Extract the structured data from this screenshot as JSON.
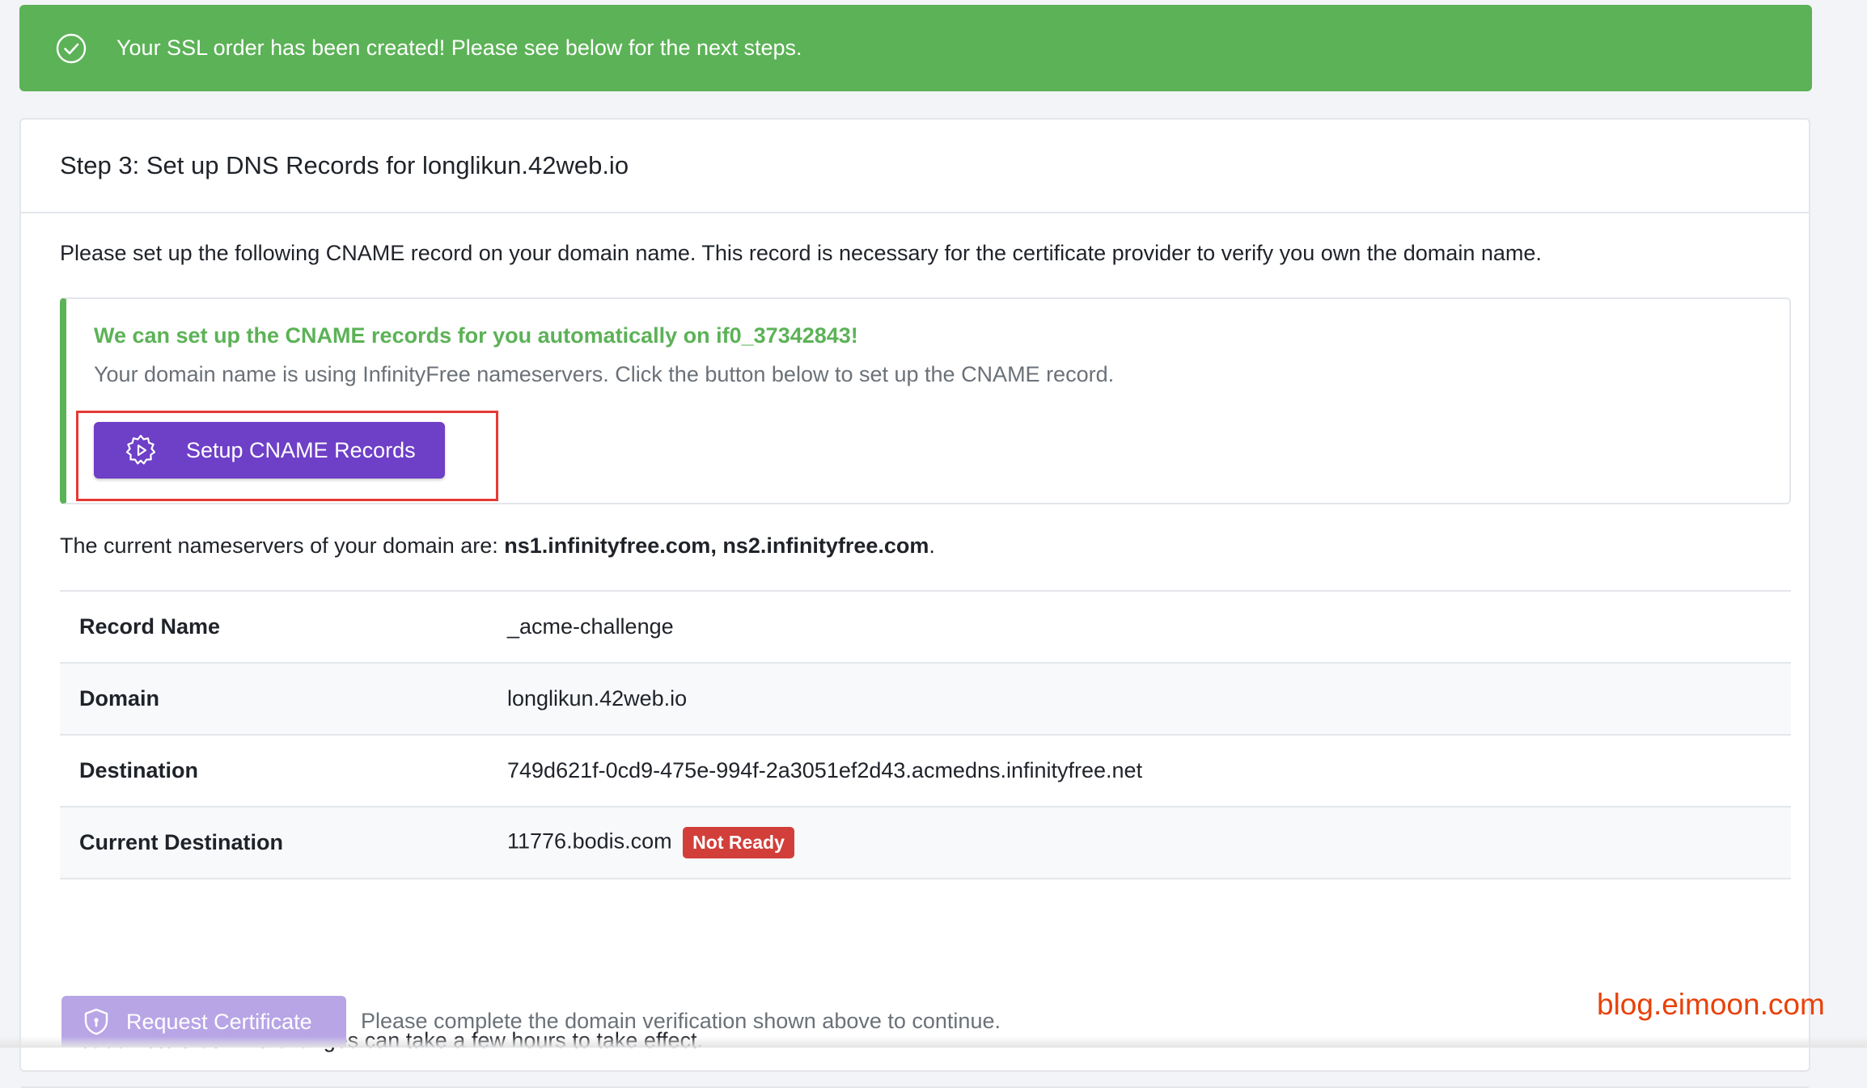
{
  "alert": {
    "message": "Your SSL order has been created! Please see below for the next steps.",
    "icon": "check-circle-icon"
  },
  "card": {
    "title": "Step 3: Set up DNS Records for longlikun.42web.io",
    "intro": "Please set up the following CNAME record on your domain name. This record is necessary for the certificate provider to verify you own the domain name."
  },
  "callout": {
    "title": "We can set up the CNAME records for you automatically on if0_37342843!",
    "description": "Your domain name is using InfinityFree nameservers. Click the button below to set up the CNAME record.",
    "button_label": "Setup CNAME Records",
    "button_icon": "gear-play-icon",
    "accent_color": "#5cb257",
    "button_color": "#6e3fc7"
  },
  "nameservers": {
    "prefix": "The current nameservers of your domain are: ",
    "value": "ns1.infinityfree.com, ns2.infinityfree.com",
    "suffix": "."
  },
  "records": [
    {
      "label": "Record Name",
      "value": "_acme-challenge"
    },
    {
      "label": "Domain",
      "value": "longlikun.42web.io"
    },
    {
      "label": "Destination",
      "value": "749d621f-0cd9-475e-994f-2a3051ef2d43.acmedns.infinityfree.net"
    },
    {
      "label": "Current Destination",
      "value": "11776.bodis.com",
      "badge": "Not Ready",
      "badge_color": "#d23f3a"
    }
  ],
  "note": "Please note that DNS changes can take a few hours to take effect.",
  "footer": {
    "request_button_label": "Request Certificate",
    "request_button_icon": "shield-icon",
    "verify_text": "Please complete the domain verification shown above to continue."
  },
  "watermark": "blog.eimoon.com"
}
